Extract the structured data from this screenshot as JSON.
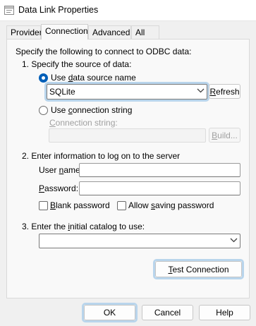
{
  "window": {
    "title": "Data Link Properties",
    "icon": "data-link-icon"
  },
  "tabs": [
    {
      "label": "Provider",
      "active": false
    },
    {
      "label": "Connection",
      "active": true
    },
    {
      "label": "Advanced",
      "active": false
    },
    {
      "label": "All",
      "active": false
    }
  ],
  "connection": {
    "intro": "Specify the following to connect to ODBC data:",
    "step1_label": "1. Specify the source of data:",
    "use_dsn": {
      "before": "Use ",
      "accel": "d",
      "after": "ata source name",
      "selected": true
    },
    "dsn_value": "SQLite",
    "refresh": {
      "accel": "R",
      "after": "efresh"
    },
    "use_connstr": {
      "before": "Use ",
      "accel": "c",
      "after": "onnection string",
      "selected": false
    },
    "connstr_label": {
      "accel": "C",
      "after": "onnection string:"
    },
    "connstr_value": "",
    "build": {
      "accel": "B",
      "after": "uild..."
    },
    "step2_label": "2. Enter information to log on to the server",
    "username": {
      "before": "User ",
      "accel": "n",
      "after": "ame:",
      "value": ""
    },
    "password": {
      "before": "",
      "accel": "P",
      "after": "assword:",
      "value": ""
    },
    "blank_password": {
      "before": "",
      "accel": "B",
      "after": "lank password",
      "checked": false
    },
    "allow_saving": {
      "before": "Allow ",
      "accel": "s",
      "after": "aving password",
      "checked": false
    },
    "step3": {
      "before": "3. Enter the ",
      "accel": "i",
      "after": "nitial catalog to use:"
    },
    "catalog_value": "",
    "test_connection": {
      "accel": "T",
      "after": "est Connection"
    }
  },
  "footer": {
    "ok": "OK",
    "cancel": "Cancel",
    "help": "Help"
  },
  "colors": {
    "accent": "#005fb8",
    "focus_ring": "#b9d5ec",
    "disabled_text": "#a0a0a0"
  }
}
